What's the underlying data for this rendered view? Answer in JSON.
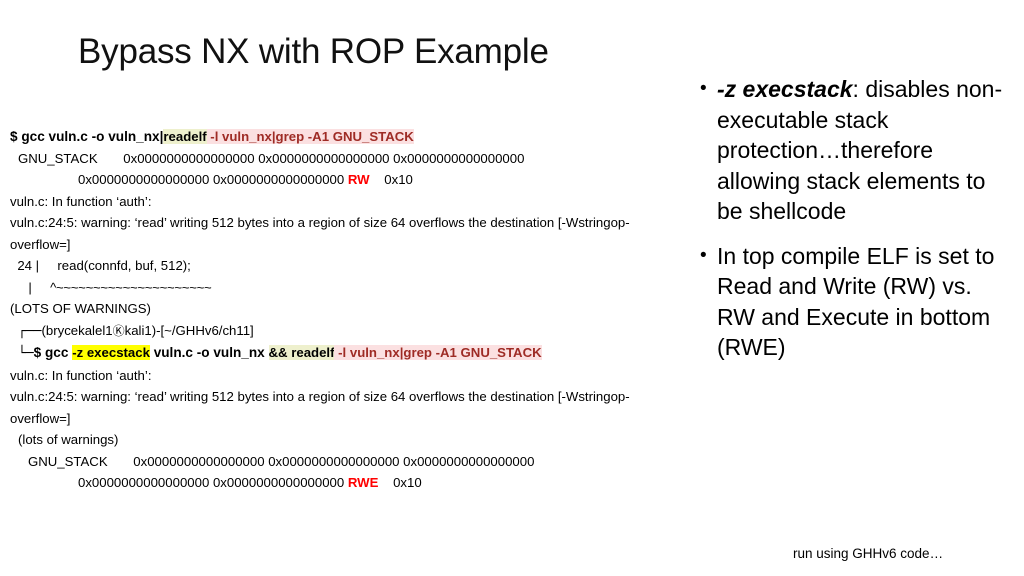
{
  "slide": {
    "title": "Bypass NX with ROP Example"
  },
  "terminal": {
    "cmd1": {
      "prompt": "$ ",
      "plain": "gcc vuln.c -o vuln_nx|",
      "cream": "readelf",
      "pink": " -l vuln_nx|grep -A1 GNU_STACK"
    },
    "out1_line1": "GNU_STACK       0x0000000000000000 0x0000000000000000 0x0000000000000000",
    "out1_line2_a": "0x0000000000000000 0x0000000000000000 ",
    "out1_line2_flags": "RW",
    "out1_line2_b": "    0x10",
    "warn1_line1": "vuln.c: In function ‘auth’:",
    "warn1_line2": "vuln.c:24:5: warning: ‘read’ writing 512 bytes into a region of size 64 overflows the destination [-Wstringop-overflow=]",
    "warn1_line3": "  24 |     read(connfd, buf, 512);",
    "warn1_line4_bar": "     |     ",
    "warn1_line4_caret": "^~~~~~~~~~~~~~~~~~~~~~",
    "warn1_line5": "(LOTS OF WARNINGS)",
    "prompt_line_box": "┌──",
    "prompt_line_user": "(brycekalel1",
    "prompt_line_at": "Ⓚ",
    "prompt_line_host": "kali1)-[~/GHHv6/ch11]",
    "cmd2": {
      "box": "└─",
      "prompt": "$ ",
      "plain_a": "gcc ",
      "yellow": "-z execstack",
      "plain_b": " vuln.c -o vuln_nx ",
      "cream": "&& readelf",
      "pink": " -l vuln_nx|grep -A1 GNU_STACK"
    },
    "warn2_line1": "vuln.c: In function ‘auth’:",
    "warn2_line2": "vuln.c:24:5: warning: ‘read’ writing 512 bytes into a region of size 64 overflows the destination [-Wstringop-overflow=]",
    "warn2_line3": "(lots of warnings)",
    "out2_line1": "GNU_STACK       0x0000000000000000 0x0000000000000000 0x0000000000000000",
    "out2_line2_a": "0x0000000000000000 0x0000000000000000 ",
    "out2_line2_flags": "RWE",
    "out2_line2_b": "    0x10"
  },
  "bullets": [
    {
      "marker": "•",
      "emphasis": "-z execstack",
      "text": ": disables non-executable stack protection…therefore allowing stack elements to be shellcode"
    },
    {
      "marker": "•",
      "emphasis": "",
      "text": "In top compile ELF is set to Read and Write (RW) vs. RW and Execute in bottom (RWE)"
    }
  ],
  "footer": {
    "note": "run using GHHv6 code…"
  },
  "colors": {
    "highlight_yellow": "#ffff00",
    "highlight_cream": "#eef0cd",
    "highlight_pink": "#fbe0e1",
    "pink_text": "#9e2b25",
    "flag_red": "#ff0000"
  }
}
